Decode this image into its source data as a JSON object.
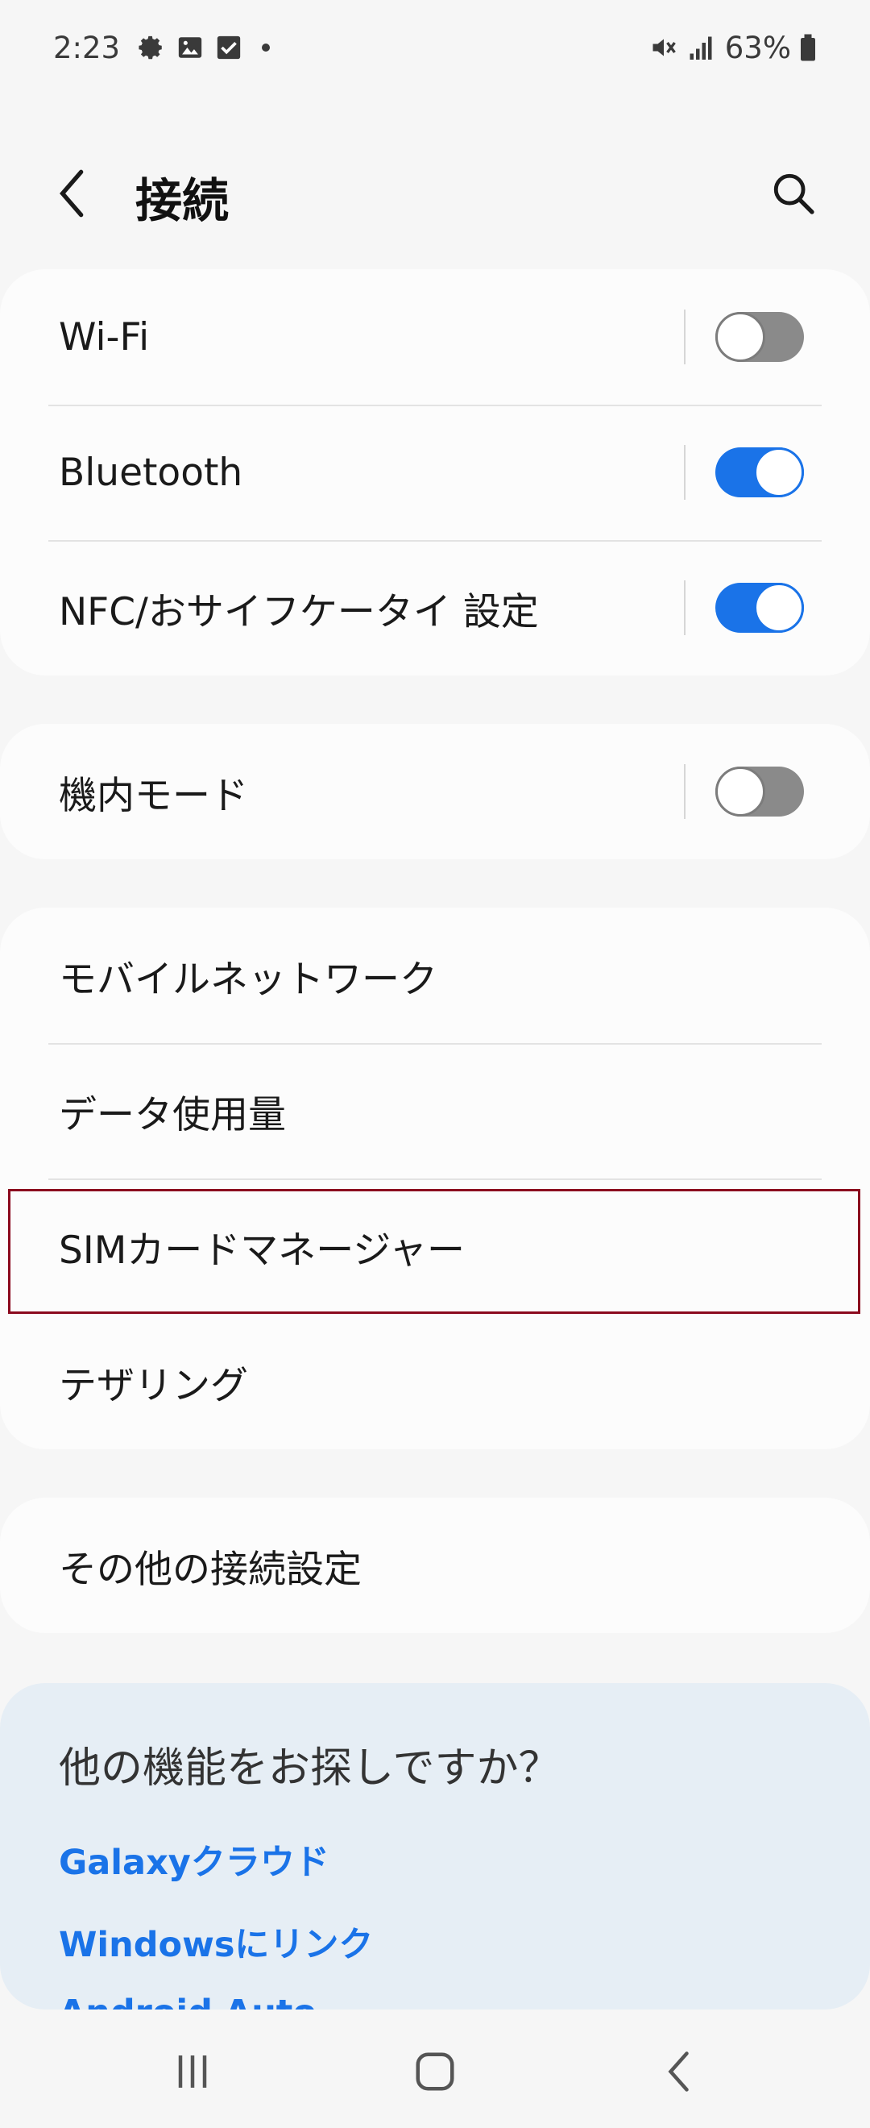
{
  "status_bar": {
    "time": "2:23",
    "left_icons": [
      "gear-icon",
      "image-icon",
      "checkbox-icon",
      "dot-icon"
    ],
    "right_icons": [
      "mute-vibrate-icon",
      "signal-icon",
      "battery-icon"
    ],
    "battery_text": "63%"
  },
  "header": {
    "title": "接続",
    "back_icon": "chevron-left-icon",
    "search_icon": "search-icon"
  },
  "connectivity_card": {
    "items": [
      {
        "label": "Wi-Fi",
        "toggle_on": false
      },
      {
        "label": "Bluetooth",
        "toggle_on": true
      },
      {
        "label": "NFC/おサイフケータイ 設定",
        "toggle_on": true
      }
    ]
  },
  "airplane_card": {
    "label": "機内モード",
    "toggle_on": false
  },
  "network_card": {
    "items": [
      {
        "label": "モバイルネットワーク"
      },
      {
        "label": "データ使用量"
      },
      {
        "label": "SIMカードマネージャー"
      },
      {
        "label": "テザリング"
      }
    ]
  },
  "more_card": {
    "label": "その他の接続設定"
  },
  "suggestions": {
    "title": "他の機能をお探しですか？",
    "links": [
      "Galaxyクラウド",
      "Windowsにリンク",
      "Android Auto"
    ]
  },
  "colors": {
    "accent": "#1a73e8",
    "highlight": "#8b0a1e",
    "toggle_off": "#8a8a8a"
  },
  "nav_bar": {
    "icons": [
      "recent-apps-icon",
      "home-icon",
      "back-icon"
    ]
  }
}
